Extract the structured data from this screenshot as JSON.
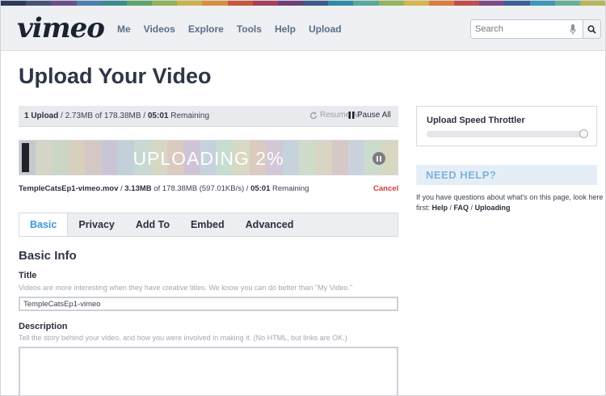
{
  "header": {
    "logo": "vimeo",
    "nav": [
      "Me",
      "Videos",
      "Explore",
      "Tools",
      "Help",
      "Upload"
    ],
    "search_placeholder": "Search"
  },
  "strip_colors": [
    "#2b3a5c",
    "#47527a",
    "#6a4e8c",
    "#4f7fb1",
    "#3c8b8e",
    "#5da36a",
    "#8fb35a",
    "#c9b24a",
    "#d88f3c",
    "#c8553e",
    "#a73f5d",
    "#6e3f78",
    "#3d5b8a",
    "#2f8aa7",
    "#58a89b",
    "#94b45b",
    "#d5b64a",
    "#db7d3b",
    "#c04d4b",
    "#7c4a87",
    "#3c5f99",
    "#3e97b6",
    "#6ab096",
    "#b8b558"
  ],
  "page_title": "Upload Your Video",
  "summary": {
    "uploads": "1 Upload",
    "sizes": " / 2.73MB of 178.38MB / ",
    "remaining_time": "05:01",
    "remaining_label": " Remaining",
    "resume_all": "Resume All",
    "pause_all": "Pause All"
  },
  "progress": {
    "percent": 2,
    "label": "UPLOADING 2%",
    "stripe_colors": [
      "#c5c9cd",
      "#d4d4c9",
      "#cbd6c4",
      "#d9cfbd",
      "#d6c7c7",
      "#c9c5d6",
      "#c3cfd9",
      "#c8d9d3",
      "#d6d8c3",
      "#dcc9bf",
      "#cfc4d5",
      "#c5d2dd",
      "#c7ddd0",
      "#d8d9c3",
      "#dccbc0",
      "#d3c6d6",
      "#c6d3dc",
      "#cfdcca",
      "#d8d5c2",
      "#d6c8c6",
      "#c9d2dc",
      "#cbdccd",
      "#d9d7c0"
    ]
  },
  "file": {
    "name": "TempleCatsEp1-vimeo.mov",
    "uploaded": "3.13MB",
    "of_total": " of 178.38MB (597.01KB/s) / ",
    "time": "05:01",
    "remaining_label": " Remaining",
    "cancel": "Cancel"
  },
  "tabs": [
    {
      "label": "Basic",
      "active": true
    },
    {
      "label": "Privacy",
      "active": false
    },
    {
      "label": "Add To",
      "active": false
    },
    {
      "label": "Embed",
      "active": false
    },
    {
      "label": "Advanced",
      "active": false
    }
  ],
  "basic_info": {
    "section_title": "Basic Info",
    "title_label": "Title",
    "title_hint": "Videos are more interesting when they have creative titles. We know you can do better than \"My Video.\"",
    "title_value": "TempleCatsEp1-vimeo",
    "description_label": "Description",
    "description_hint": "Tell the story behind your video, and how you were involved in making it. (No HTML, but links are OK.)",
    "description_value": ""
  },
  "throttler": {
    "title": "Upload Speed Throttler",
    "level_percent": 100
  },
  "help": {
    "title": "NEED HELP?",
    "text": "If you have questions about what's on this page, look here first: ",
    "links": [
      "Help",
      "FAQ",
      "Uploading"
    ],
    "separator": " / "
  }
}
